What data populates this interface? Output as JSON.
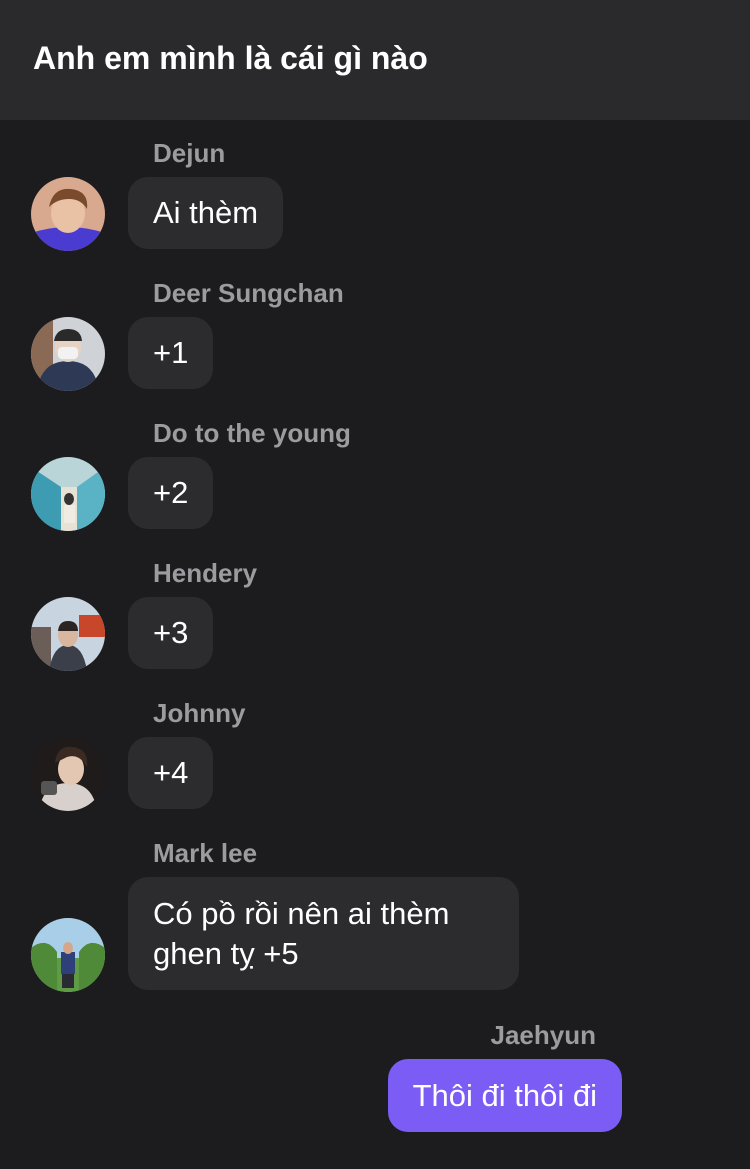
{
  "header": {
    "title": "Anh em mình là cái gì nào"
  },
  "messages": [
    {
      "sender": "Dejun",
      "text": "Ai thèm"
    },
    {
      "sender": "Deer Sungchan",
      "text": "+1"
    },
    {
      "sender": "Do to the young",
      "text": "+2"
    },
    {
      "sender": "Hendery",
      "text": "+3"
    },
    {
      "sender": "Johnny",
      "text": "+4"
    },
    {
      "sender": "Mark lee",
      "text": "Có pồ rồi nên ai thèm ghen tỵ +5"
    }
  ],
  "own_message": {
    "sender": "Jaehyun",
    "text": "Thôi đi thôi đi"
  },
  "colors": {
    "background": "#1c1c1e",
    "header": "#2a2a2c",
    "bubble": "#2c2c2e",
    "own_bubble": "#7b5cf5",
    "sender_name": "#9b9ba0"
  }
}
